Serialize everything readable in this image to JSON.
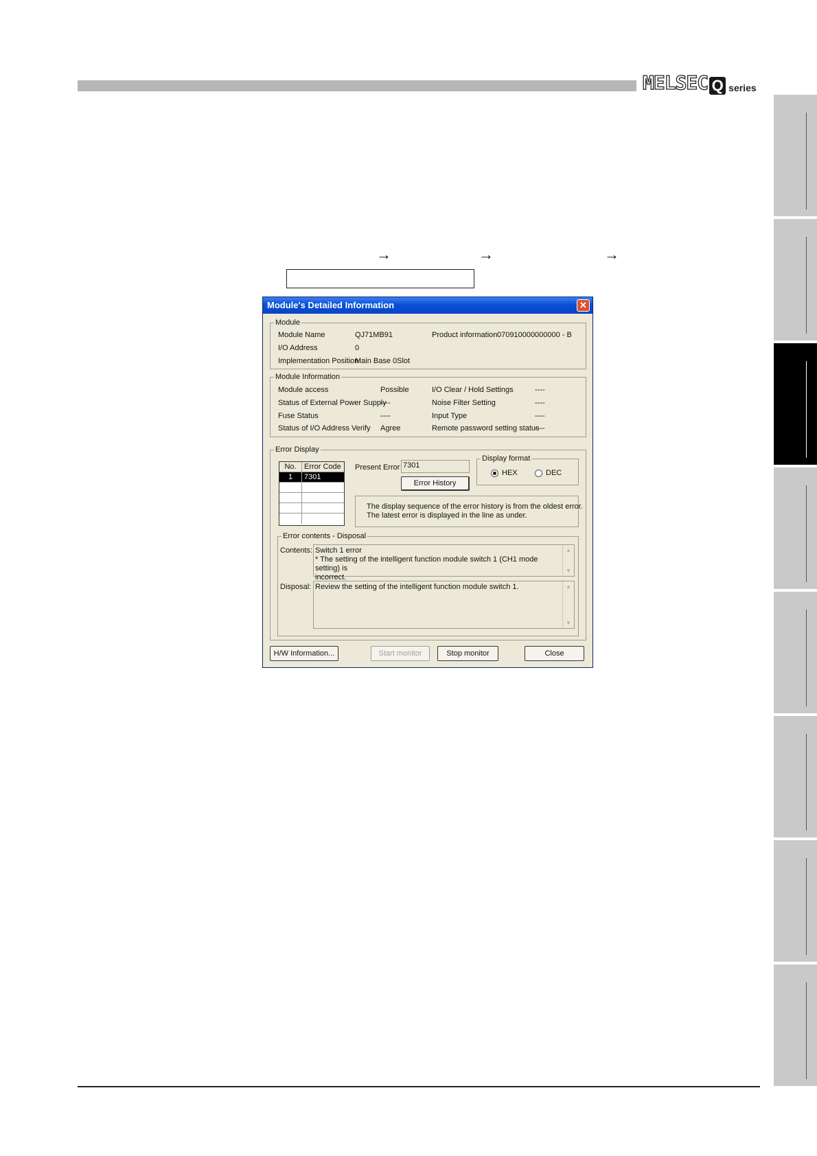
{
  "brand": {
    "name": "MELSEC",
    "letter": "Q",
    "series": "series"
  },
  "nav_arrows": [
    "→",
    "→",
    "→"
  ],
  "dialog": {
    "title": "Module's Detailed Information",
    "close_symbol": "✕",
    "module": {
      "legend": "Module",
      "module_name_label": "Module Name",
      "module_name_value": "QJ71MB91",
      "product_info_label": "Product information",
      "product_info_value": "070910000000000 - B",
      "io_address_label": "I/O Address",
      "io_address_value": "0",
      "impl_position_label": "Implementation Position",
      "impl_position_value": "Main Base  0Slot"
    },
    "module_information": {
      "legend": "Module Information",
      "left": [
        {
          "label": "Module access",
          "value": "Possible"
        },
        {
          "label": "Status of External Power Supply",
          "value": "----"
        },
        {
          "label": "Fuse Status",
          "value": "----"
        },
        {
          "label": "Status of I/O Address Verify",
          "value": "Agree"
        }
      ],
      "right": [
        {
          "label": "I/O Clear / Hold Settings",
          "value": "----"
        },
        {
          "label": "Noise Filter Setting",
          "value": "----"
        },
        {
          "label": "Input Type",
          "value": "----"
        },
        {
          "label": "Remote password setting status",
          "value": "----"
        }
      ]
    },
    "error_display": {
      "legend": "Error Display",
      "table_headers": [
        "No.",
        "Error Code"
      ],
      "rows": [
        {
          "no": "1",
          "code": "7301"
        }
      ],
      "present_error_label": "Present Error",
      "present_error_value": "7301",
      "error_history_button": "Error History",
      "display_format": {
        "legend": "Display format",
        "options": [
          "HEX",
          "DEC"
        ],
        "selected": "HEX"
      },
      "note_line1": "The display sequence of the error history is from the oldest error.",
      "note_line2": "The latest error is displayed in the line as under."
    },
    "error_contents": {
      "legend": "Error contents - Disposal",
      "contents_label": "Contents:",
      "contents_line1": "Switch 1 error",
      "contents_line2": "* The setting of the intelligent function module switch 1 (CH1 mode setting) is",
      "contents_line3": "incorrect.",
      "disposal_label": "Disposal:",
      "disposal_text": "Review the setting of the intelligent function module switch 1."
    },
    "buttons": {
      "hw_info": "H/W Information...",
      "start_monitor": "Start monitor",
      "stop_monitor": "Stop monitor",
      "close": "Close"
    }
  },
  "colors": {
    "titlebar": "#0a4fd6",
    "dialog_bg": "#ece9d8",
    "side_tab": "#c9c9c9",
    "side_tab_active": "#000000",
    "header_bar": "#b6b6b6"
  }
}
